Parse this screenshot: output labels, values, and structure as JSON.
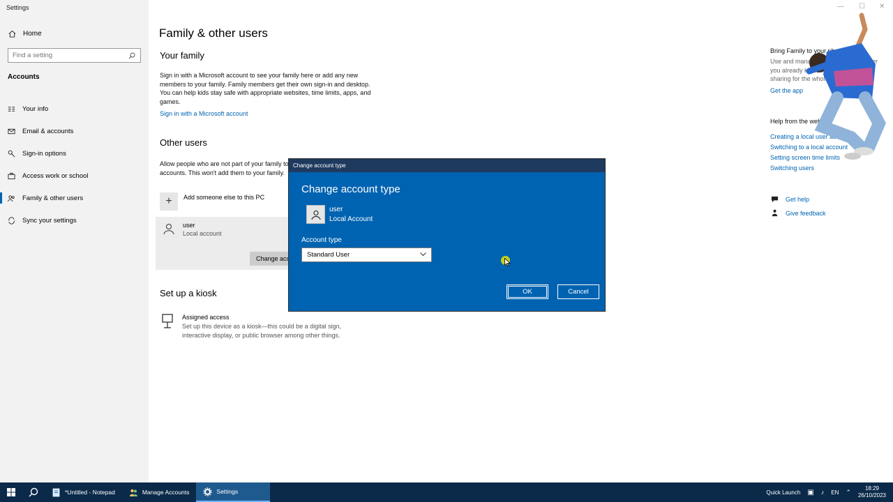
{
  "app": {
    "title": "Settings"
  },
  "sidebar": {
    "home_label": "Home",
    "search_placeholder": "Find a setting",
    "section_label": "Accounts",
    "items": [
      {
        "label": "Your info",
        "icon": "person-card-icon"
      },
      {
        "label": "Email & accounts",
        "icon": "mail-icon"
      },
      {
        "label": "Sign-in options",
        "icon": "key-icon"
      },
      {
        "label": "Access work or school",
        "icon": "briefcase-icon"
      },
      {
        "label": "Family & other users",
        "icon": "people-icon"
      },
      {
        "label": "Sync your settings",
        "icon": "sync-icon"
      }
    ],
    "active_index": 4
  },
  "main": {
    "page_title": "Family & other users",
    "your_family": {
      "heading": "Your family",
      "text": "Sign in with a Microsoft account to see your family here or add any new members to your family. Family members get their own sign-in and desktop. You can help kids stay safe with appropriate websites, time limits, apps, and games.",
      "link": "Sign in with a Microsoft account"
    },
    "other_users": {
      "heading": "Other users",
      "text": "Allow people who are not part of your family to sign in with their own accounts. This won't add them to your family.",
      "add_label": "Add someone else to this PC",
      "user_name": "user",
      "user_type": "Local account",
      "change_button": "Change account type"
    },
    "kiosk": {
      "heading": "Set up a kiosk",
      "title": "Assigned access",
      "desc": "Set up this device as a kiosk—this could be a digital sign, interactive display, or public browser among other things."
    }
  },
  "right": {
    "bring_heading": "Bring Family to your phone",
    "bring_text": "Use and manage your family wherever you already know with your phone, sharing for the whole family.",
    "get_app": "Get the app",
    "help_heading": "Help from the web",
    "help_links": [
      "Creating a local user account",
      "Switching to a local account",
      "Setting screen time limits",
      "Switching users"
    ],
    "get_help": "Get help",
    "give_feedback": "Give feedback"
  },
  "dialog": {
    "titlebar": "Change account type",
    "heading": "Change account type",
    "user_name": "user",
    "user_type": "Local Account",
    "account_type_label": "Account type",
    "selected": "Standard User",
    "ok": "OK",
    "cancel": "Cancel",
    "accent": "#0063b1"
  },
  "taskbar": {
    "apps": [
      {
        "label": "*Untitled - Notepad",
        "icon": "notepad-icon"
      },
      {
        "label": "Manage Accounts",
        "icon": "users-icon"
      },
      {
        "label": "Settings",
        "icon": "gear-icon"
      }
    ],
    "quick_launch": "Quick Launch",
    "language": "EN",
    "time": "18:29",
    "date": "26/10/2023"
  }
}
